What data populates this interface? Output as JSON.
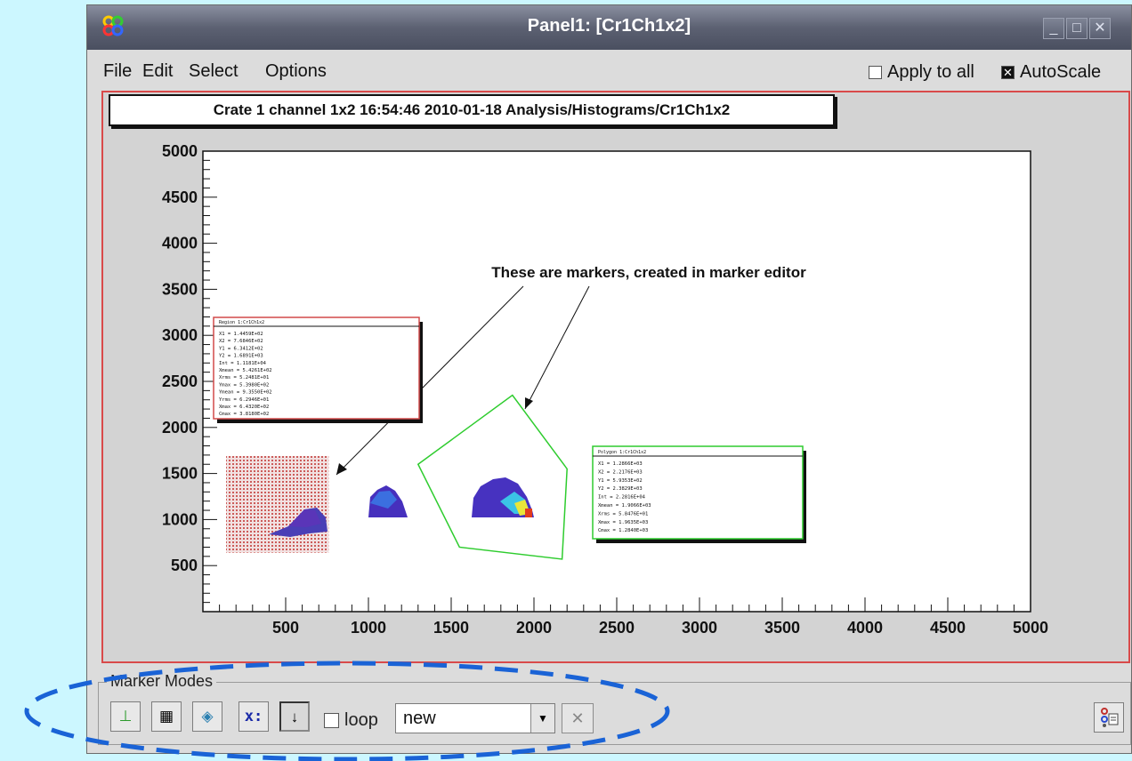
{
  "window": {
    "title": "Panel1: [Cr1Ch1x2]",
    "controls": {
      "minimize": "_",
      "maximize": "□",
      "close": "✕"
    }
  },
  "menu": [
    "File",
    "Edit",
    "Select",
    "Options"
  ],
  "toggles": {
    "apply_to_all": {
      "label": "Apply to all",
      "checked": false
    },
    "autoscale": {
      "label": "AutoScale",
      "checked": true
    }
  },
  "histogram": {
    "title": "Crate 1 channel 1x2  16:54:46  2010-01-18  Analysis/Histograms/Cr1Ch1x2",
    "annotation": "These are markers, created in marker editor"
  },
  "chart_data": {
    "type": "heatmap",
    "xlim": [
      0,
      5000
    ],
    "ylim": [
      0,
      5000
    ],
    "xticks": [
      500,
      1000,
      1500,
      2000,
      2500,
      3000,
      3500,
      4000,
      4500,
      5000
    ],
    "yticks": [
      500,
      1000,
      1500,
      2000,
      2500,
      3000,
      3500,
      4000,
      4500,
      5000
    ],
    "marker_polygon": [
      [
        1300,
        1600
      ],
      [
        1870,
        2350
      ],
      [
        2200,
        1550
      ],
      [
        2170,
        570
      ],
      [
        1550,
        700
      ]
    ],
    "marker_region": {
      "x1": 140,
      "x2": 760,
      "y1": 640,
      "y2": 1690
    },
    "stats_boxes": [
      {
        "title": "Region 1:Cr1Ch1x2",
        "lines": [
          "X1    = 1.4459E+02",
          "X2    = 7.6846E+02",
          "Y1    = 6.3412E+02",
          "Y2    = 1.6891E+03",
          "Int    = 1.1181E+04",
          "Xmean = 5.4261E+02",
          "Xrms  = 5.2481E+01",
          "Ymax  = 5.3980E+02",
          "Ymean = 9.3550E+02",
          "Yrms  = 6.2946E+01",
          "Xmax  = 6.4320E+02",
          "Cmax  = 3.8180E+02"
        ]
      },
      {
        "title": "Polygon 1:Cr1Ch1x2",
        "lines": [
          "X1    = 1.2866E+03",
          "X2    = 2.2176E+03",
          "Y1    = 5.9353E+02",
          "Y2    = 2.3829E+03",
          "Int    = 2.2816E+04",
          "Xmean = 1.9066E+03",
          "Xrms  = 5.8476E+01",
          "Xmax  = 1.9635E+03",
          "Cmax  = 1.2840E+03"
        ]
      }
    ]
  },
  "marker_modes": {
    "label": "Marker Modes",
    "tools": [
      {
        "name": "cut-tool",
        "glyph": "⊥"
      },
      {
        "name": "region-tool",
        "glyph": "▦"
      },
      {
        "name": "polygon-tool",
        "glyph": "◈"
      },
      {
        "name": "x-tool",
        "glyph": "x:"
      },
      {
        "name": "arrow-down-tool",
        "glyph": "↓"
      }
    ],
    "loop_label": "loop",
    "loop_checked": false,
    "select_value": "new",
    "clear_glyph": "✕"
  }
}
